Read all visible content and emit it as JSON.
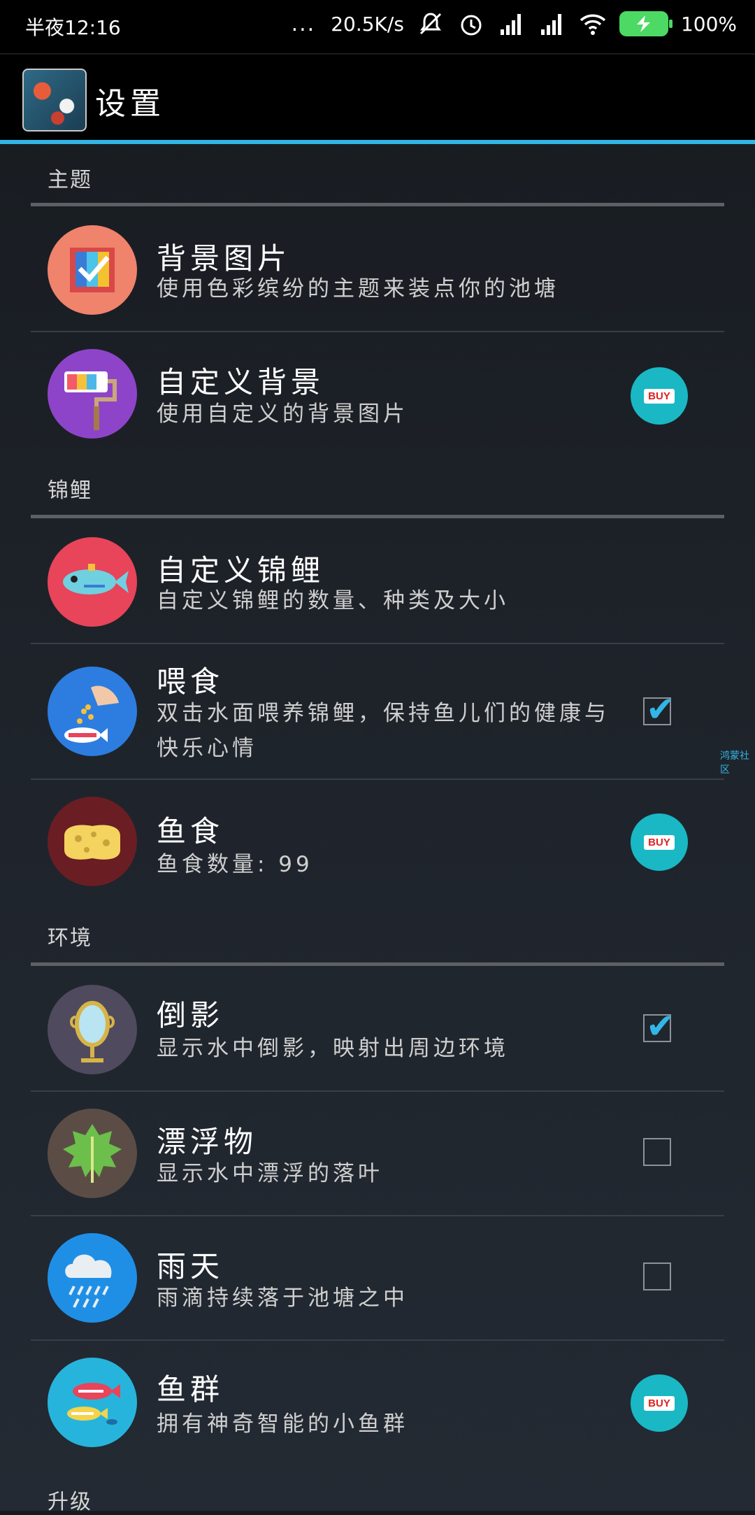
{
  "status_bar": {
    "time": "半夜12:16",
    "dots": "...",
    "net_speed": "20.5K/s",
    "battery": "100%"
  },
  "app_bar": {
    "title": "设置"
  },
  "sections": [
    {
      "header": "主题",
      "items": [
        {
          "title": "背景图片",
          "subtitle": "使用色彩缤纷的主题来装点你的池塘",
          "control": "none",
          "icon": "palette-icon"
        },
        {
          "title": "自定义背景",
          "subtitle": "使用自定义的背景图片",
          "control": "buy",
          "icon": "paint-roller-icon"
        }
      ]
    },
    {
      "header": "锦鲤",
      "items": [
        {
          "title": "自定义锦鲤",
          "subtitle": "自定义锦鲤的数量、种类及大小",
          "control": "none",
          "icon": "fish-icon"
        },
        {
          "title": "喂食",
          "subtitle": "双击水面喂养锦鲤，保持鱼儿们的健康与快乐心情",
          "control": "checkbox",
          "checked": true,
          "icon": "feeding-hand-icon"
        },
        {
          "title": "鱼食",
          "subtitle": "鱼食数量: 99",
          "control": "buy",
          "icon": "sponge-icon"
        }
      ]
    },
    {
      "header": "环境",
      "items": [
        {
          "title": "倒影",
          "subtitle": "显示水中倒影，映射出周边环境",
          "control": "checkbox",
          "checked": true,
          "icon": "mirror-icon"
        },
        {
          "title": "漂浮物",
          "subtitle": "显示水中漂浮的落叶",
          "control": "checkbox",
          "checked": false,
          "icon": "leaf-icon"
        },
        {
          "title": "雨天",
          "subtitle": "雨滴持续落于池塘之中",
          "control": "checkbox",
          "checked": false,
          "icon": "rain-cloud-icon"
        },
        {
          "title": "鱼群",
          "subtitle": "拥有神奇智能的小鱼群",
          "control": "buy",
          "icon": "fish-school-icon"
        }
      ]
    },
    {
      "header": "升级",
      "items": []
    }
  ],
  "buy_label": "BUY",
  "checkmark": "✔",
  "side_tag": "鸿蒙社区",
  "colors": {
    "accent": "#33b5e5",
    "buy_bg": "#19b8c4"
  }
}
